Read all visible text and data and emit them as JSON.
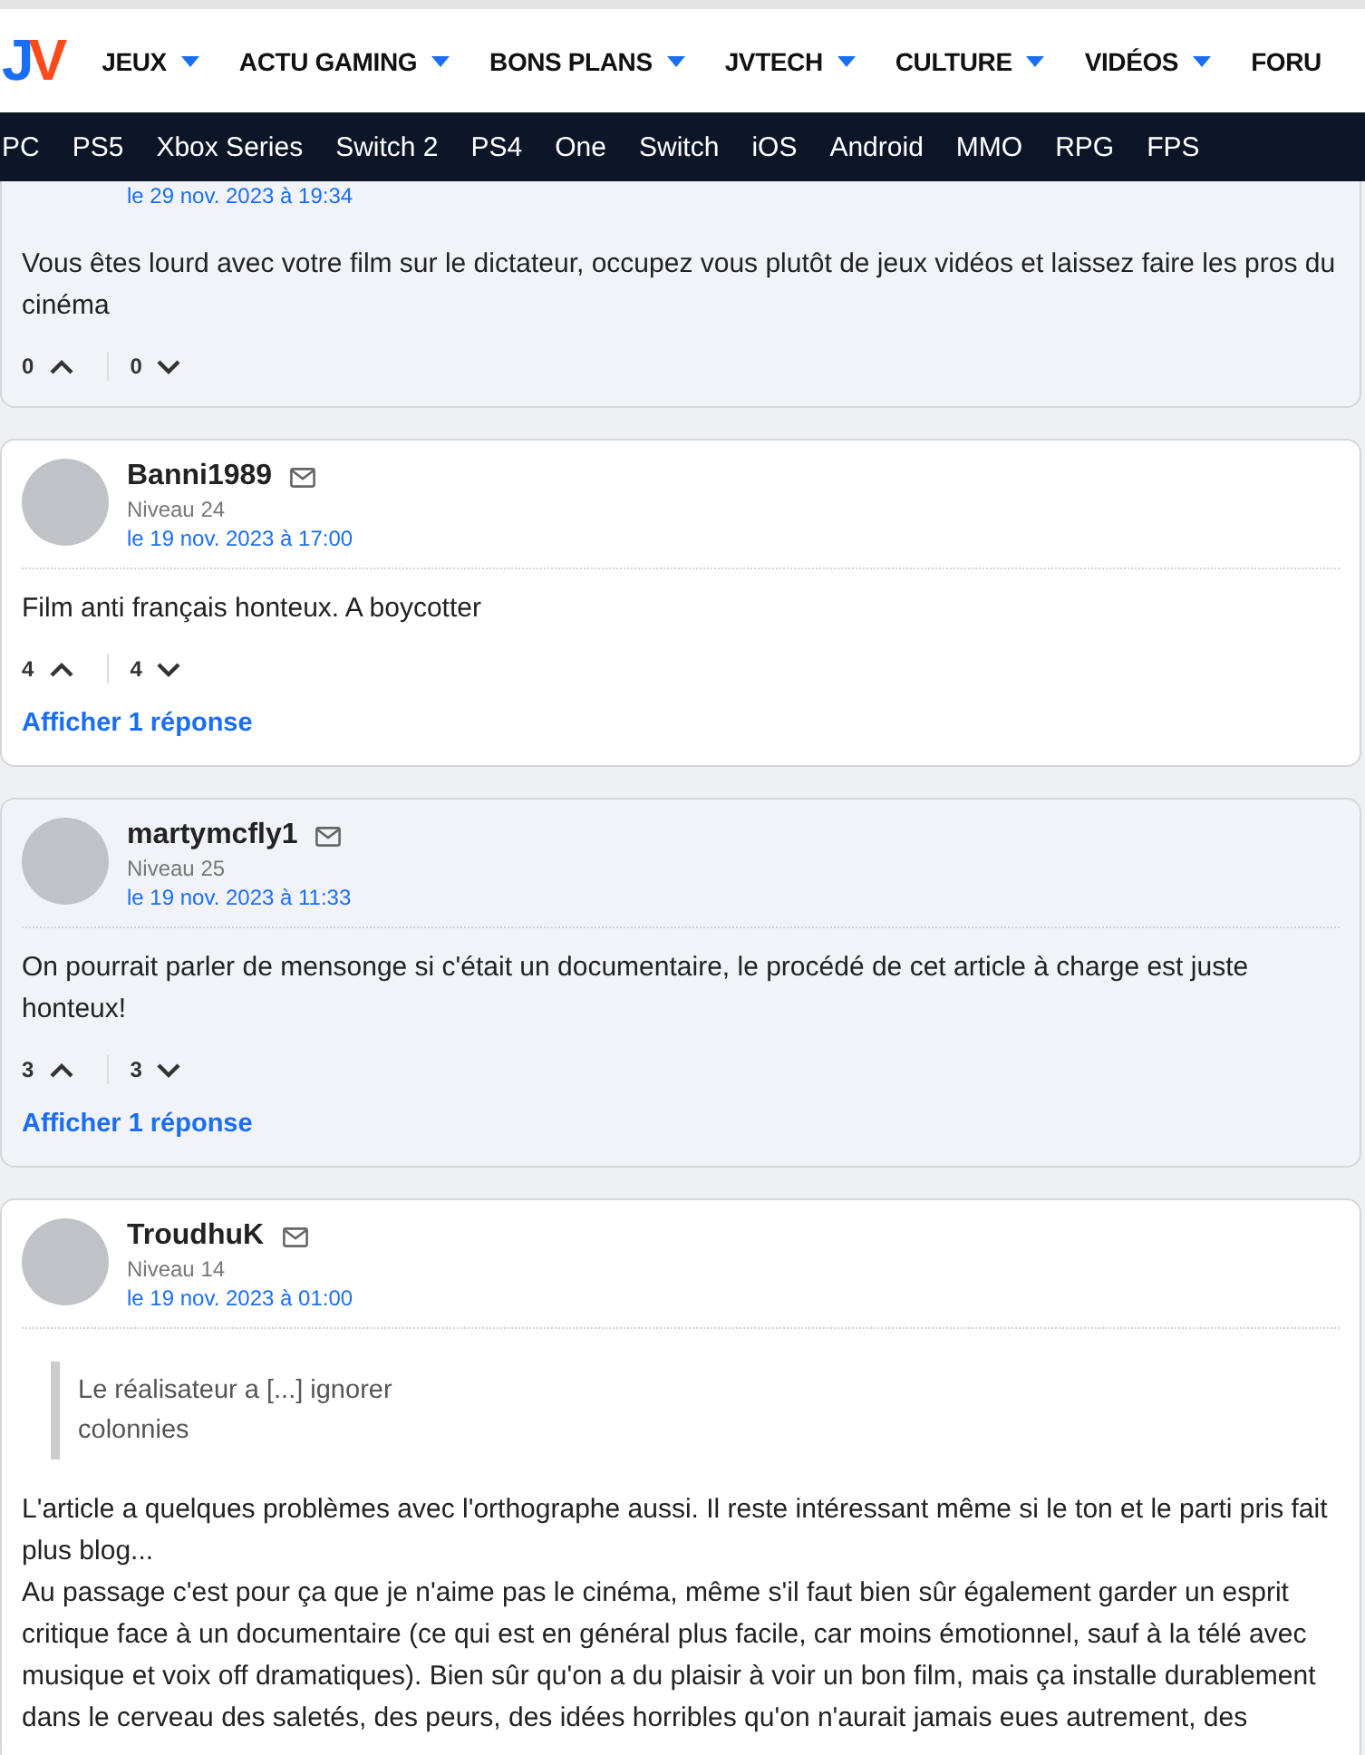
{
  "header": {
    "logo": {
      "first": "J",
      "second": "V"
    },
    "menu": [
      {
        "label": "JEUX",
        "dropdown": true
      },
      {
        "label": "ACTU GAMING",
        "dropdown": true
      },
      {
        "label": "BONS PLANS",
        "dropdown": true
      },
      {
        "label": "JVTECH",
        "dropdown": true
      },
      {
        "label": "CULTURE",
        "dropdown": true
      },
      {
        "label": "VIDÉOS",
        "dropdown": true
      },
      {
        "label": "FORU",
        "dropdown": false
      }
    ]
  },
  "platforms": [
    "PC",
    "PS5",
    "Xbox Series",
    "Switch 2",
    "PS4",
    "One",
    "Switch",
    "iOS",
    "Android",
    "MMO",
    "RPG",
    "FPS"
  ],
  "comments": [
    {
      "highlighted": true,
      "date": "le 29 nov. 2023 à 19:34",
      "body": [
        "Vous êtes lourd avec votre film sur le dictateur, occupez vous plutôt de jeux vidéos et laissez faire les pros du cinéma"
      ],
      "upvotes": "0",
      "downvotes": "0"
    },
    {
      "highlighted": false,
      "author": "Banni1989",
      "level": "Niveau 24",
      "date": "le 19 nov. 2023 à 17:00",
      "body": [
        "Film anti français honteux. A boycotter"
      ],
      "upvotes": "4",
      "downvotes": "4",
      "replies": "Afficher 1 réponse"
    },
    {
      "highlighted": true,
      "author": "martymcfly1",
      "level": "Niveau 25",
      "date": "le 19 nov. 2023 à 11:33",
      "body": [
        "On pourrait parler de mensonge si c'était un documentaire, le procédé de cet article à charge est juste honteux!"
      ],
      "upvotes": "3",
      "downvotes": "3",
      "replies": "Afficher 1 réponse"
    },
    {
      "highlighted": false,
      "author": "TroudhuK",
      "level": "Niveau 14",
      "date": "le 19 nov. 2023 à 01:00",
      "quote": [
        "Le réalisateur a [...] ignorer",
        "colonnies"
      ],
      "body": [
        "L'article a quelques problèmes avec l'orthographe aussi. Il reste intéressant même si le ton et le parti pris fait plus blog...",
        "Au passage c'est pour ça que je n'aime pas le cinéma, même s'il faut bien sûr également garder un esprit critique face à un documentaire (ce qui est en général plus facile, car moins émotionnel, sauf à la télé avec musique et voix off dramatiques). Bien sûr qu'on a du plaisir à voir un bon film, mais ça installe durablement dans le cerveau des saletés, des peurs, des idées horribles qu'on n'aurait jamais eues autrement, des"
      ]
    }
  ]
}
